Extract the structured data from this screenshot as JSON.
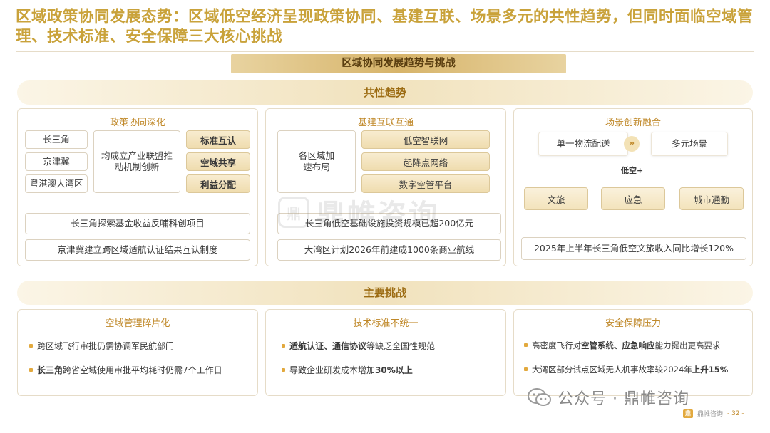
{
  "title": "区域政策协同发展态势：区域低空经济呈现政策协同、基建互联、场景多元的共性趋势，但同时面临空域管理、技术标准、安全保障三大核心挑战",
  "banner": "区域协同发展趋势与挑战",
  "trends": {
    "label": "共性趋势",
    "policy": {
      "title": "政策协同深化",
      "regions": [
        "长三角",
        "京津冀",
        "粤港澳大湾区"
      ],
      "center": "均成立产业联盟推动机制创新",
      "tags": [
        "标准互认",
        "空域共享",
        "利益分配"
      ],
      "facts": [
        "长三角探索基金收益反哺科创项目",
        "京津冀建立跨区域适航认证结果互认制度"
      ]
    },
    "infra": {
      "title": "基建互联互通",
      "center": "各区域加速布局",
      "tags": [
        "低空智联网",
        "起降点网络",
        "数字空管平台"
      ],
      "facts": [
        "长三角低空基础设施投资规模已超200亿元",
        "大湾区计划2026年前建成1000条商业航线"
      ]
    },
    "scene": {
      "title": "场景创新融合",
      "from": "单一物流配送",
      "arrow": "»",
      "to": "多元场景",
      "plus": "低空+",
      "tags": [
        "文旅",
        "应急",
        "城市通勤"
      ],
      "fact": "2025年上半年长三角低空文旅收入同比增长120%"
    }
  },
  "challenges": {
    "label": "主要挑战",
    "airspace": {
      "title": "空域管理碎片化",
      "items": [
        {
          "pre": "跨区域飞行审批仍需协调军民航部门",
          "bold": "",
          "post": ""
        },
        {
          "pre": "",
          "bold": "长三角",
          "post": "跨省空域使用审批平均耗时仍需7个工作日"
        }
      ]
    },
    "standard": {
      "title": "技术标准不统一",
      "items": [
        {
          "pre": "",
          "bold": "适航认证、通信协议",
          "post": "等缺乏全国性规范"
        },
        {
          "pre": "导致企业研发成本增加",
          "bold": "30%以上",
          "post": ""
        }
      ]
    },
    "safety": {
      "title": "安全保障压力",
      "items": [
        {
          "pre": "高密度飞行对",
          "bold": "空管系统、应急响应",
          "post": "能力提出更高要求"
        },
        {
          "pre": "大湾区部分试点区域无人机事故率较2024年",
          "bold": "上升15%",
          "post": ""
        }
      ]
    }
  },
  "watermark": {
    "logo": "鼎",
    "text": "鼎帷咨询"
  },
  "footer": {
    "text": "公众号 · 鼎帷咨询",
    "page_logo": "鼎",
    "page_brand": "鼎帷咨询",
    "page_num": "- 32 -"
  },
  "colors": {
    "accent": "#c9a23a",
    "accent_dark": "#9c6b12",
    "dot": "#e2a93e",
    "border": "#e6dcc8"
  }
}
